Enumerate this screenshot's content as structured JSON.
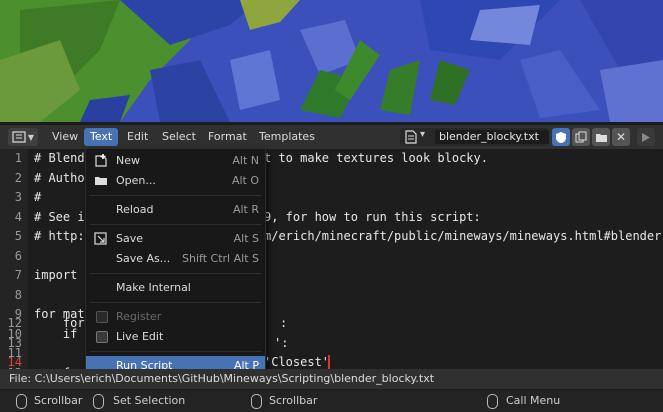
{
  "header": {
    "menus": [
      "View",
      "Text",
      "Edit",
      "Select",
      "Format",
      "Templates"
    ],
    "active_menu": "Text",
    "filename": "blender_blocky.txt"
  },
  "code_lines": [
    {
      "num": "1",
      "text": "# Blend"
    },
    {
      "num": "2",
      "text": "# Autho"
    },
    {
      "num": "3",
      "text": "#"
    },
    {
      "num": "4",
      "text": "# See i"
    },
    {
      "num": "5",
      "text": "# http:"
    },
    {
      "num": "6",
      "text": ""
    },
    {
      "num": "7",
      "text": "import"
    },
    {
      "num": "8",
      "text": ""
    },
    {
      "num": "9",
      "text": "for mat"
    },
    {
      "num": "10",
      "text": "    if"
    },
    {
      "num": "11",
      "text": ""
    },
    {
      "num": "12",
      "text": "    for"
    },
    {
      "num": "13",
      "text": ""
    },
    {
      "num": "14",
      "text": ""
    }
  ],
  "code_overlay": {
    "line1_tail": "t to make textures look blocky.",
    "line4_tail": "9, for how to run this script:",
    "line5_tail": "m/erich/minecraft/public/mineways/mineways.html#blender",
    "line12_tail": ":",
    "line13_tail": "':",
    "line14_tail": "'Closest'"
  },
  "text_menu": {
    "items": [
      {
        "label": "New",
        "shortcut": "Alt N",
        "icon": "new-file-icon"
      },
      {
        "label": "Open...",
        "shortcut": "Alt O",
        "icon": "folder-icon"
      },
      {
        "label": "Reload",
        "shortcut": "Alt R"
      },
      {
        "label": "Save",
        "shortcut": "Alt S",
        "icon": "save-icon"
      },
      {
        "label": "Save As...",
        "shortcut": "Shift Ctrl Alt S"
      },
      {
        "label": "Make Internal",
        "shortcut": ""
      },
      {
        "label": "Register",
        "shortcut": "",
        "disabled": true
      },
      {
        "label": "Live Edit",
        "shortcut": ""
      },
      {
        "label": "Run Script",
        "shortcut": "Alt P",
        "highlighted": true
      }
    ]
  },
  "footer": {
    "file_path": "File: C:\\Users\\erich\\Documents\\GitHub\\Mineways\\Scripting\\blender_blocky.txt"
  },
  "statusbar": {
    "items": [
      "Scrollbar",
      "Set Selection",
      "Scrollbar",
      "Call Menu"
    ]
  },
  "colors": {
    "accent": "#4772b3",
    "cursor": "#e03030",
    "viewport_blue": "#3d4fb8",
    "viewport_green": "#3f8a2a"
  }
}
